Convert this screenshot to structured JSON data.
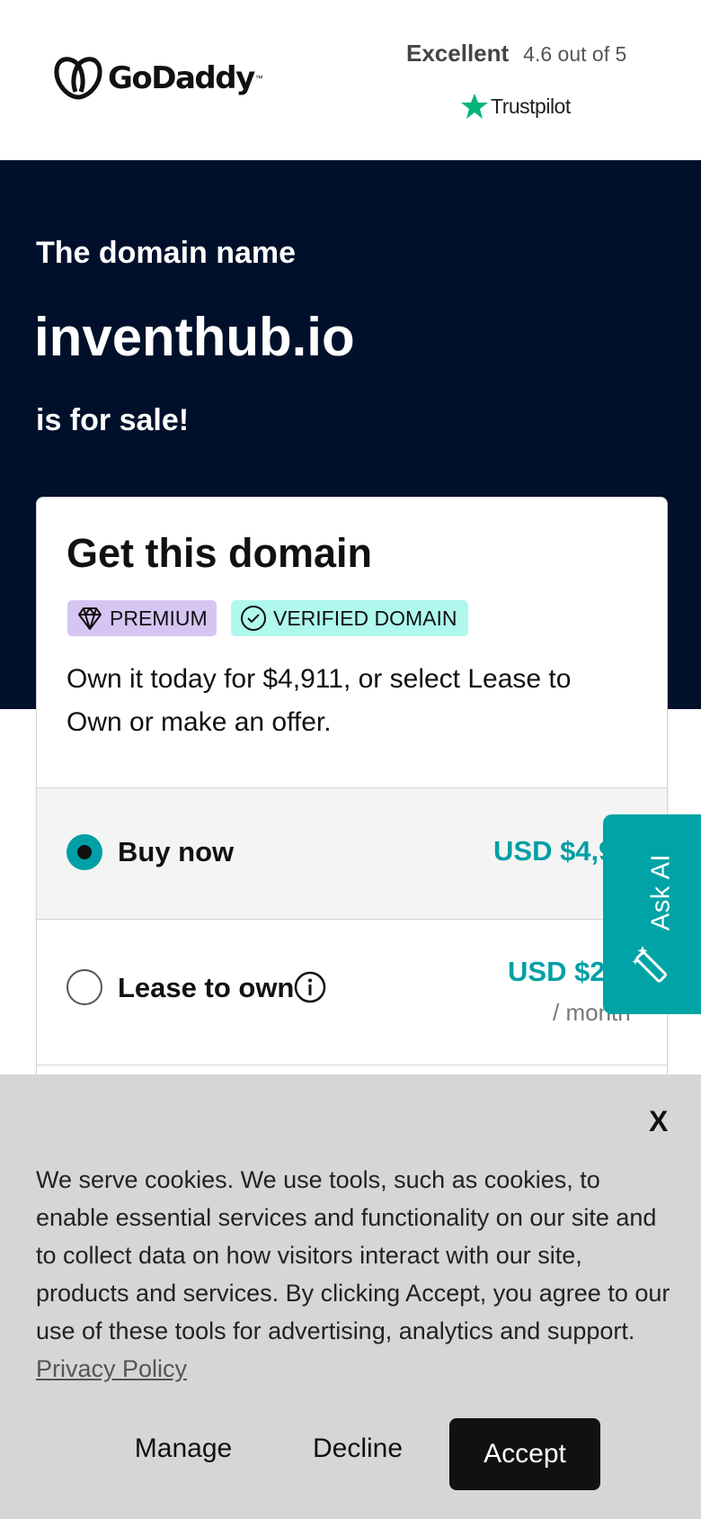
{
  "header": {
    "logo_text": "GoDaddy",
    "logo_tm": "™",
    "trustpilot": {
      "rating_word": "Excellent",
      "score_text": "4.6 out of 5",
      "brand": "Trustpilot",
      "star_color": "#00b67a"
    }
  },
  "hero": {
    "intro": "The domain name",
    "domain": "inventhub.io",
    "suffix": "is for sale!",
    "background": "#00102b"
  },
  "card": {
    "title": "Get this domain",
    "badges": [
      {
        "label": "PREMIUM",
        "icon": "diamond-icon",
        "color": "#d6c5f3"
      },
      {
        "label": "VERIFIED DOMAIN",
        "icon": "check-circle-icon",
        "color": "#aff8ed"
      }
    ],
    "description": "Own it today for $4,911, or select Lease to Own or make an offer.",
    "options": [
      {
        "label": "Buy now",
        "price": "USD $4,911",
        "selected": true
      },
      {
        "label": "Lease to own",
        "price": "USD $205",
        "period": "/ month",
        "selected": false,
        "info_icon": "info-icon"
      }
    ],
    "accent": "#009fa6"
  },
  "ask_ai": {
    "label": "Ask AI",
    "icon": "magic-wand-icon",
    "color": "#00a4a6"
  },
  "cookie_banner": {
    "close_label": "X",
    "text": "We serve cookies. We use tools, such as cookies, to enable essential services and functionality on our site and to collect data on how visitors interact with our site, products and services. By clicking Accept, you agree to our use of these tools for advertising, analytics and support.",
    "privacy_link": "Privacy Policy",
    "manage_label": "Manage",
    "decline_label": "Decline",
    "accept_label": "Accept"
  }
}
